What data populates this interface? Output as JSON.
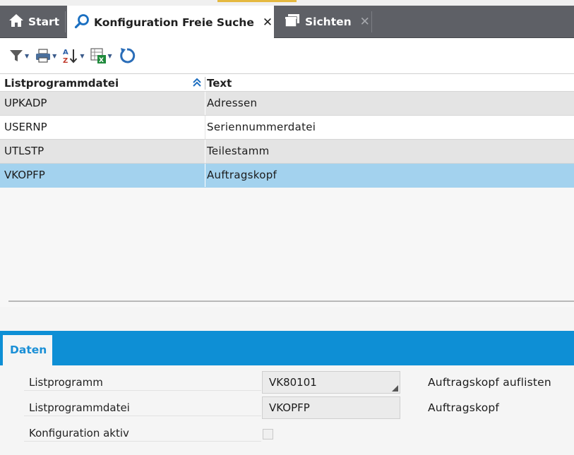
{
  "tabs": [
    {
      "label": "Start",
      "icon": "home-icon"
    },
    {
      "label": "Konfiguration Freie Suche",
      "icon": "search-icon",
      "close": "✕",
      "active": true
    },
    {
      "label": "Sichten",
      "icon": "windows-icon",
      "close": "✕"
    }
  ],
  "toolbar": {
    "items": [
      "filter-icon",
      "print-icon",
      "sort-az-icon",
      "excel-export-icon",
      "refresh-icon"
    ]
  },
  "grid": {
    "columns": [
      "Listprogrammdatei",
      "Text"
    ],
    "sort_indicator": "sort-ascending-icon",
    "rows": [
      {
        "listprogrammdatei": "UPKADP",
        "text": "Adressen"
      },
      {
        "listprogrammdatei": "USERNP",
        "text": "Seriennummerdatei"
      },
      {
        "listprogrammdatei": "UTLSTP",
        "text": "Teilestamm"
      },
      {
        "listprogrammdatei": "VKOPFP",
        "text": "Auftragskopf",
        "selected": true
      }
    ]
  },
  "detail": {
    "tab": "Daten",
    "fields": [
      {
        "label": "Listprogramm",
        "value": "VK80101",
        "description": "Auftragskopf auflisten"
      },
      {
        "label": "Listprogrammdatei",
        "value": "VKOPFP",
        "description": "Auftragskopf"
      },
      {
        "label": "Konfiguration aktiv",
        "checked": false
      }
    ]
  },
  "colors": {
    "tabbar": "#5e6066",
    "accent_blue": "#0e8fd5",
    "selected_row": "#a3d2ee",
    "odd_row": "#e4e4e4"
  }
}
